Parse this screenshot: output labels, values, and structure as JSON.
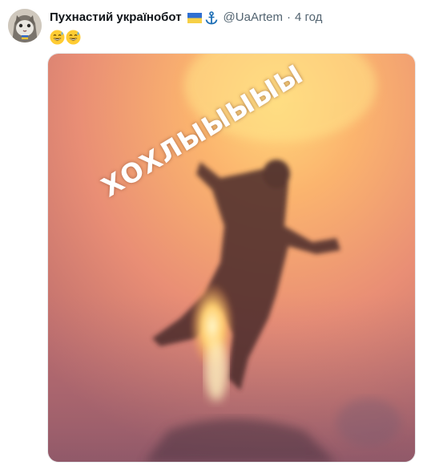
{
  "tweet": {
    "display_name": "Пухнастий українобот",
    "handle": "@UaArtem",
    "separator": "·",
    "time": "4 год",
    "emojis": [
      "grinning-sweat-emoji",
      "grinning-sweat-emoji"
    ],
    "media": {
      "overlay_text": "ХОХЛЫЫЫЫЫ"
    }
  },
  "colors": {
    "name": "#0f1419",
    "secondary": "#536471",
    "flag_blue": "#2f6fd1",
    "flag_yellow": "#f7d046",
    "anchor": "#1d6fb6"
  }
}
